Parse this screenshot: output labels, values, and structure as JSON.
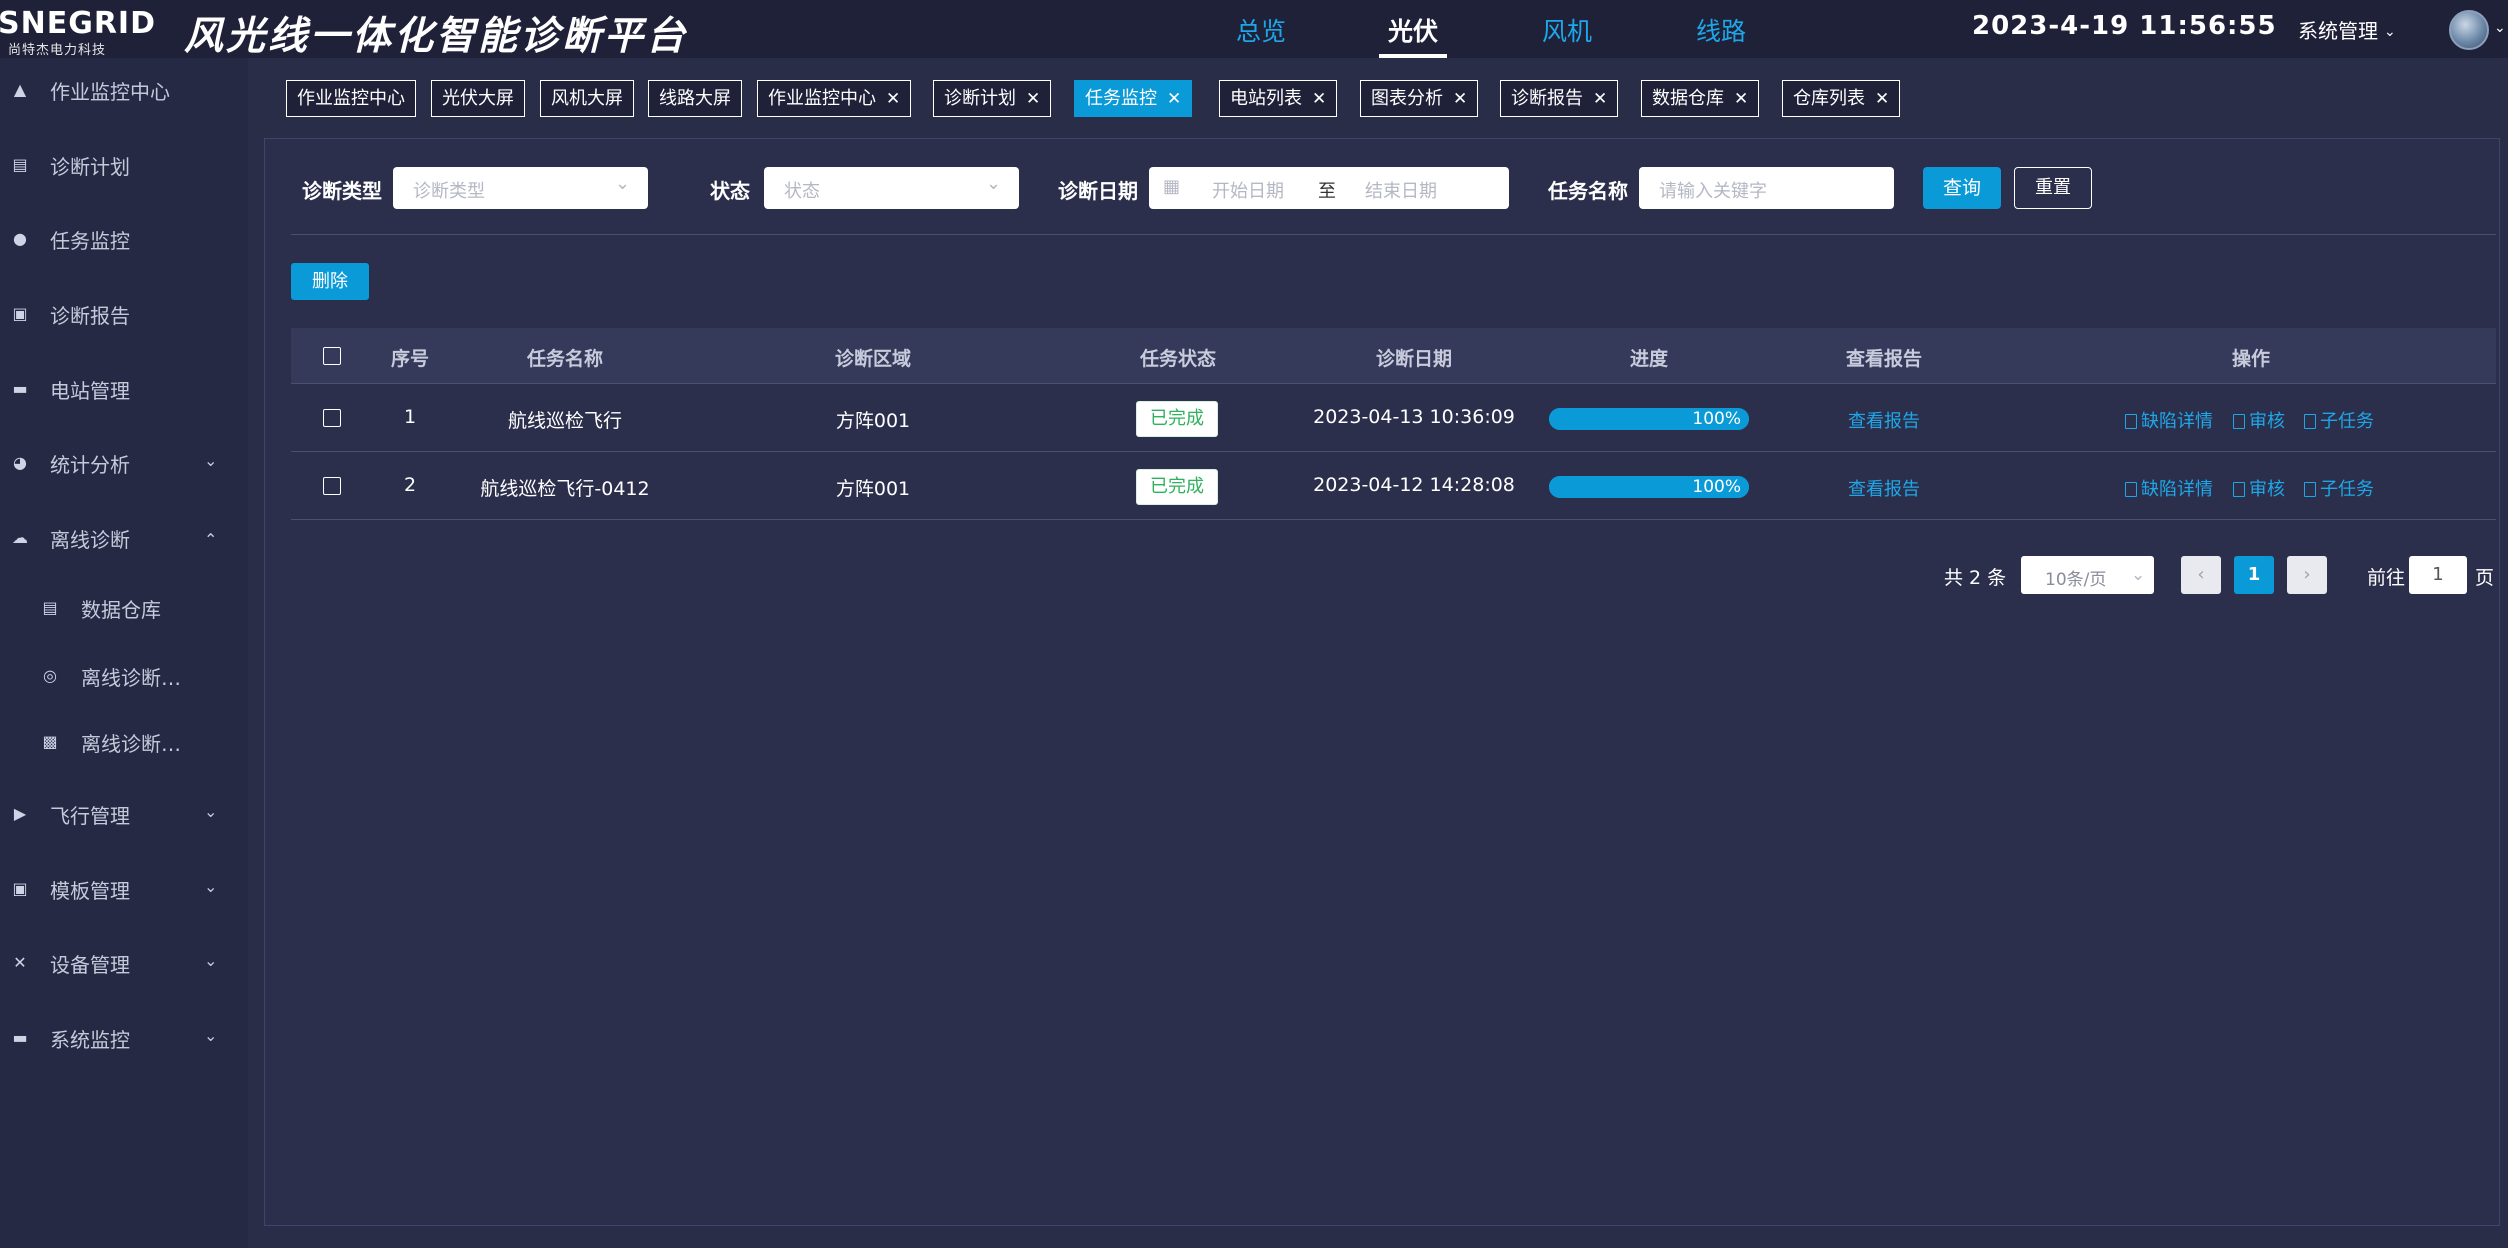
{
  "header": {
    "logo_text": "SNEGRID",
    "logo_sub": "尚特杰电力科技",
    "app_title": "风光线一体化智能诊断平台",
    "nav": [
      {
        "label": "总览",
        "active": false
      },
      {
        "label": "光伏",
        "active": true
      },
      {
        "label": "风机",
        "active": false
      },
      {
        "label": "线路",
        "active": false
      }
    ],
    "datetime": "2023-4-19 11:56:55",
    "system_menu": "系统管理"
  },
  "sidebar": {
    "items": [
      {
        "label": "作业监控中心",
        "icon": "dashboard-icon"
      },
      {
        "label": "诊断计划",
        "icon": "monitor-icon"
      },
      {
        "label": "任务监控",
        "icon": "location-icon"
      },
      {
        "label": "诊断报告",
        "icon": "report-icon"
      },
      {
        "label": "电站管理",
        "icon": "station-icon"
      },
      {
        "label": "统计分析",
        "icon": "pie-chart-icon"
      },
      {
        "label": "离线诊断",
        "icon": "cloud-offline-icon"
      },
      {
        "label": "数据仓库",
        "icon": "database-icon"
      },
      {
        "label": "离线诊断…",
        "icon": "diagnose-icon"
      },
      {
        "label": "离线诊断…",
        "icon": "image-icon"
      },
      {
        "label": "飞行管理",
        "icon": "play-icon"
      },
      {
        "label": "模板管理",
        "icon": "template-icon"
      },
      {
        "label": "设备管理",
        "icon": "tools-icon"
      },
      {
        "label": "系统监控",
        "icon": "screen-icon"
      }
    ]
  },
  "tags": [
    {
      "label": "作业监控中心",
      "closable": false,
      "active": false
    },
    {
      "label": "光伏大屏",
      "closable": false,
      "active": false
    },
    {
      "label": "风机大屏",
      "closable": false,
      "active": false
    },
    {
      "label": "线路大屏",
      "closable": false,
      "active": false
    },
    {
      "label": "作业监控中心",
      "closable": true,
      "active": false
    },
    {
      "label": "诊断计划",
      "closable": true,
      "active": false
    },
    {
      "label": "任务监控",
      "closable": true,
      "active": true
    },
    {
      "label": "电站列表",
      "closable": true,
      "active": false
    },
    {
      "label": "图表分析",
      "closable": true,
      "active": false
    },
    {
      "label": "诊断报告",
      "closable": true,
      "active": false
    },
    {
      "label": "数据仓库",
      "closable": true,
      "active": false
    },
    {
      "label": "仓库列表",
      "closable": true,
      "active": false
    }
  ],
  "filters": {
    "type_label": "诊断类型",
    "type_placeholder": "诊断类型",
    "status_label": "状态",
    "status_placeholder": "状态",
    "date_label": "诊断日期",
    "date_start_placeholder": "开始日期",
    "date_sep": "至",
    "date_end_placeholder": "结束日期",
    "name_label": "任务名称",
    "name_placeholder": "请输入关键字",
    "query_button": "查询",
    "reset_button": "重置"
  },
  "delete_button": "删除",
  "table": {
    "headers": [
      "序号",
      "任务名称",
      "诊断区域",
      "任务状态",
      "诊断日期",
      "进度",
      "查看报告",
      "操作"
    ],
    "rows": [
      {
        "index": "1",
        "name": "航线巡检飞行",
        "area": "方阵001",
        "status": "已完成",
        "date": "2023-04-13 10:36:09",
        "progress": 100,
        "progress_text": "100%",
        "report": "查看报告",
        "actions": [
          "缺陷详情",
          "审核",
          "子任务"
        ]
      },
      {
        "index": "2",
        "name": "航线巡检飞行-0412",
        "area": "方阵001",
        "status": "已完成",
        "date": "2023-04-12 14:28:08",
        "progress": 100,
        "progress_text": "100%",
        "report": "查看报告",
        "actions": [
          "缺陷详情",
          "审核",
          "子任务"
        ]
      }
    ]
  },
  "pagination": {
    "total": "共 2 条",
    "page_size": "10条/页",
    "current_page": "1",
    "goto_label": "前往",
    "goto_value": "1",
    "page_suffix": "页"
  },
  "colors": {
    "accent": "#0b9ad8",
    "background": "#2a2d48",
    "success": "#2fb15e"
  }
}
